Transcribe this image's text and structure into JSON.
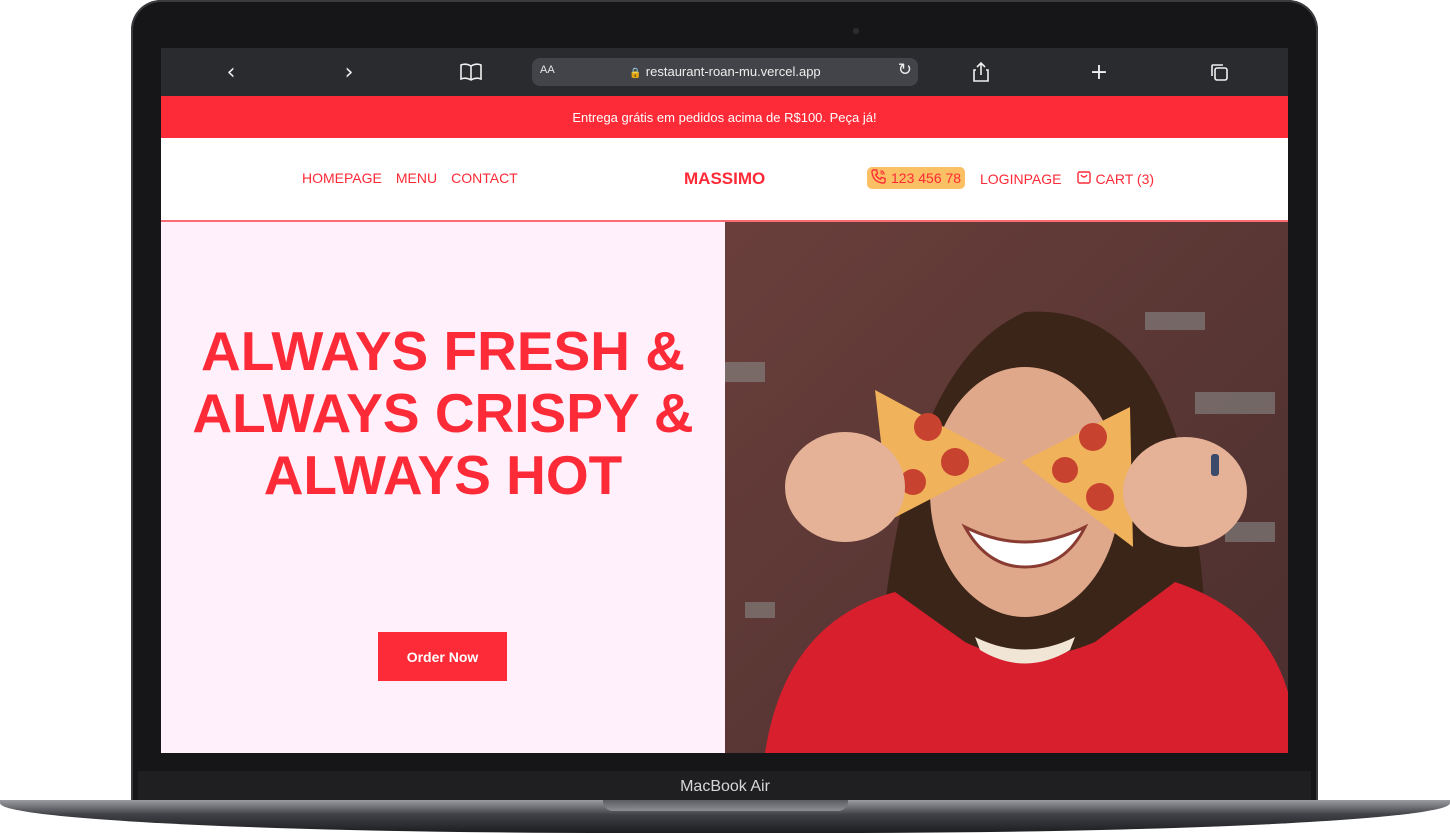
{
  "browser": {
    "back_icon": "chevron-left-icon",
    "forward_icon": "chevron-right-icon",
    "bookmarks_icon": "book-icon",
    "text_size_label": "AA",
    "url": "restaurant-roan-mu.vercel.app",
    "reload_icon": "reload-icon",
    "share_icon": "share-icon",
    "new_tab_icon": "plus-icon",
    "tabs_icon": "tabs-icon"
  },
  "promo": {
    "text": "Entrega grátis em pedidos acima de R$100. Peça já!"
  },
  "header": {
    "nav_left": [
      "HOMEPAGE",
      "MENU",
      "CONTACT"
    ],
    "brand": "MASSIMO",
    "phone": "123 456 78",
    "login": "LOGINPAGE",
    "cart": "CART (3)"
  },
  "hero": {
    "title": "ALWAYS FRESH & ALWAYS CRISPY & ALWAYS HOT",
    "cta": "Order Now"
  },
  "device": {
    "label": "MacBook Air"
  },
  "colors": {
    "brand_red": "#fd2a37",
    "hero_bg": "#fff0fb",
    "phone_badge": "#fbbf64"
  }
}
